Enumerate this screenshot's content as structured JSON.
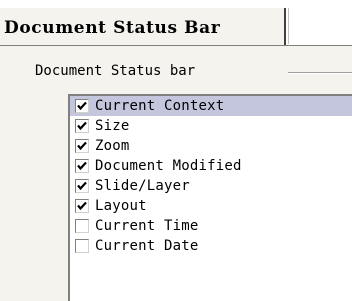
{
  "tab": {
    "label": "Document Status Bar"
  },
  "group": {
    "title": "Document Status bar"
  },
  "items": [
    {
      "label": "Current Context",
      "checked": true,
      "selected": true
    },
    {
      "label": "Size",
      "checked": true,
      "selected": false
    },
    {
      "label": "Zoom",
      "checked": true,
      "selected": false
    },
    {
      "label": "Document Modified",
      "checked": true,
      "selected": false
    },
    {
      "label": "Slide/Layer",
      "checked": true,
      "selected": false
    },
    {
      "label": "Layout",
      "checked": true,
      "selected": false
    },
    {
      "label": "Current Time",
      "checked": false,
      "selected": false
    },
    {
      "label": "Current Date",
      "checked": false,
      "selected": false
    }
  ],
  "colors": {
    "selection": "#c4c6de",
    "panel": "#f4f3ee"
  }
}
